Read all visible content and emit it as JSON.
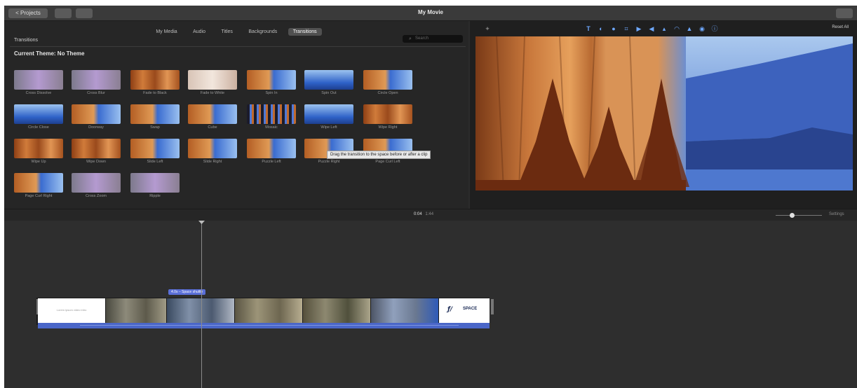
{
  "window": {
    "title": "My Movie",
    "projects_button": "< Projects",
    "extra_buttons": [
      "",
      ""
    ],
    "right_button": ""
  },
  "browser": {
    "tabs": [
      {
        "label": "My Media",
        "active": false
      },
      {
        "label": "Audio",
        "active": false
      },
      {
        "label": "Titles",
        "active": false
      },
      {
        "label": "Backgrounds",
        "active": false
      },
      {
        "label": "Transitions",
        "active": true
      }
    ],
    "section_label": "Transitions",
    "search_placeholder": "Search",
    "theme_label": "Current Theme: No Theme",
    "tooltip": "Drag the transition to the space before or after a clip",
    "transitions": [
      {
        "label": "Cross Dissolve",
        "style": "cross"
      },
      {
        "label": "Cross Blur",
        "style": "cross"
      },
      {
        "label": "Fade to Black",
        "style": "rock"
      },
      {
        "label": "Fade to White",
        "style": "fadew"
      },
      {
        "label": "Spin In",
        "style": "split"
      },
      {
        "label": "Spin Out",
        "style": "blue"
      },
      {
        "label": "Circle Open",
        "style": "split"
      },
      {
        "label": "Circle Close",
        "style": "blue"
      },
      {
        "label": "Doorway",
        "style": "split"
      },
      {
        "label": "Swap",
        "style": "split"
      },
      {
        "label": "Cube",
        "style": "split"
      },
      {
        "label": "Mosaic",
        "style": "mosaic"
      },
      {
        "label": "Wipe Left",
        "style": "blue"
      },
      {
        "label": "Wipe Right",
        "style": "rock"
      },
      {
        "label": "Wipe Up",
        "style": "rock"
      },
      {
        "label": "Wipe Down",
        "style": "rock"
      },
      {
        "label": "Slide Left",
        "style": "split"
      },
      {
        "label": "Slide Right",
        "style": "split"
      },
      {
        "label": "Puzzle Left",
        "style": "split"
      },
      {
        "label": "Puzzle Right",
        "style": "split"
      },
      {
        "label": "Page Curl Left",
        "style": "split"
      },
      {
        "label": "Page Curl Right",
        "style": "split"
      },
      {
        "label": "Cross Zoom",
        "style": "cross"
      },
      {
        "label": "Ripple",
        "style": "cross"
      }
    ]
  },
  "viewer": {
    "tools": [
      "wand-icon",
      "text-icon",
      "color-icon",
      "palette-icon",
      "crop-icon",
      "camera-icon",
      "volume-icon",
      "chart-icon",
      "speed-icon",
      "stabilize-icon",
      "filter-icon",
      "info-icon"
    ],
    "reset_label": "Reset All",
    "accent_color": "#6ea8ff"
  },
  "timeline": {
    "timecode": "0:04",
    "total": "1:44",
    "settings_label": "Settings",
    "clip_label": "4.0s – Space shuttle",
    "intro_text": "Lorem ipsum video intro",
    "logo_text": "SPACE"
  }
}
